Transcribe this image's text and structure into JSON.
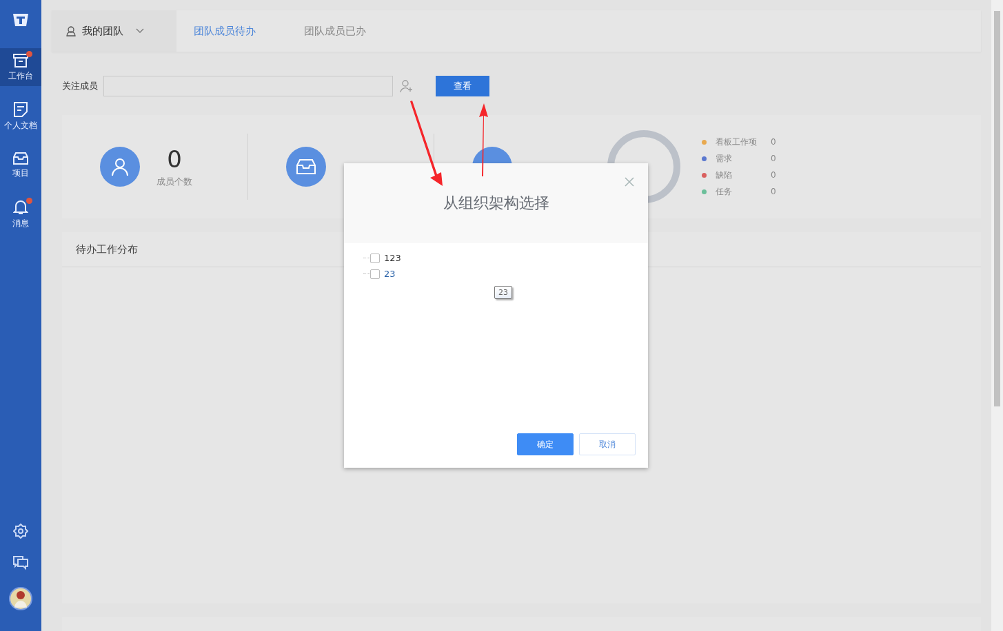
{
  "sidebar": {
    "items": [
      {
        "label": "工作台",
        "selected": true,
        "badge": true
      },
      {
        "label": "个人文档",
        "selected": false,
        "badge": false
      },
      {
        "label": "项目",
        "selected": false,
        "badge": false
      },
      {
        "label": "消息",
        "selected": false,
        "badge": true
      }
    ]
  },
  "team_selector": {
    "label": "我的团队"
  },
  "tabs": [
    {
      "label": "团队成员待办",
      "selected": true
    },
    {
      "label": "团队成员已办",
      "selected": false
    }
  ],
  "filter": {
    "label": "关注成员",
    "button": "查看"
  },
  "stats": [
    {
      "value": "0",
      "label": "成员个数"
    }
  ],
  "legend": [
    {
      "label": "看板工作项",
      "value": "0",
      "color": "#e8a94f"
    },
    {
      "label": "需求",
      "value": "0",
      "color": "#5b78cf"
    },
    {
      "label": "缺陷",
      "value": "0",
      "color": "#d9605f"
    },
    {
      "label": "任务",
      "value": "0",
      "color": "#6bbf9a"
    }
  ],
  "panel": {
    "title": "待办工作分布"
  },
  "dialog": {
    "title": "从组织架构选择",
    "tree": [
      {
        "label": "123",
        "checked": false,
        "hovered": false
      },
      {
        "label": "23",
        "checked": false,
        "hovered": true
      }
    ],
    "tooltip": "23",
    "buttons": [
      {
        "label": "确定",
        "kind": "primary"
      },
      {
        "label": "取消",
        "kind": "secondary"
      }
    ]
  }
}
